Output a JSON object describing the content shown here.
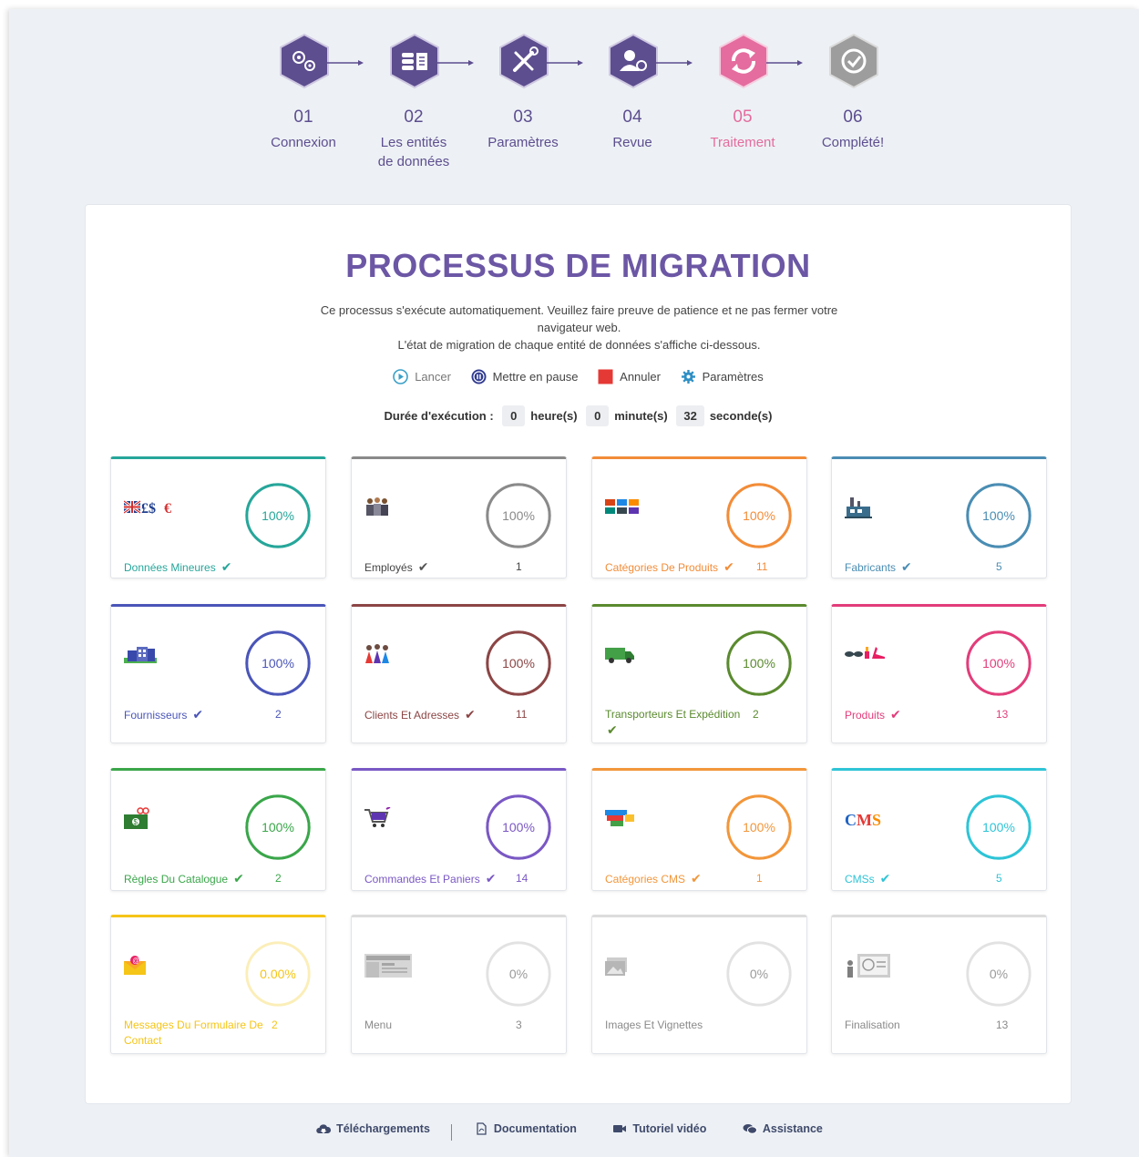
{
  "steps": [
    {
      "num": "01",
      "label": "Connexion",
      "state": "done"
    },
    {
      "num": "02",
      "label": "Les entités de données",
      "state": "done"
    },
    {
      "num": "03",
      "label": "Paramètres",
      "state": "done"
    },
    {
      "num": "04",
      "label": "Revue",
      "state": "done"
    },
    {
      "num": "05",
      "label": "Traitement",
      "state": "active"
    },
    {
      "num": "06",
      "label": "Complété!",
      "state": "pending"
    }
  ],
  "main": {
    "title": "PROCESSUS DE MIGRATION",
    "desc_line1": "Ce processus s'exécute automatiquement. Veuillez faire preuve de patience et ne pas fermer votre navigateur web.",
    "desc_line2": "L'état de migration de chaque entité de données s'affiche ci-dessous.",
    "controls": {
      "start": "Lancer",
      "pause": "Mettre en pause",
      "cancel": "Annuler",
      "settings": "Paramètres"
    },
    "duration": {
      "label": "Durée d'exécution :",
      "hours": "0",
      "hours_unit": "heure(s)",
      "minutes": "0",
      "minutes_unit": "minute(s)",
      "seconds": "32",
      "seconds_unit": "seconde(s)"
    }
  },
  "entities": [
    {
      "name": "Données Mineures",
      "percent": "100%",
      "progress": 1.0,
      "count": "",
      "color": "#26a69a",
      "checked": true,
      "icon": "currency-flags-icon"
    },
    {
      "name": "Employés",
      "percent": "100%",
      "progress": 1.0,
      "count": "1",
      "color": "#8a8a8a",
      "checked": true,
      "icon": "employees-icon"
    },
    {
      "name": "Catégories De Produits",
      "percent": "100%",
      "progress": 1.0,
      "count": "11",
      "color": "#f28c38",
      "checked": true,
      "icon": "categories-grid-icon"
    },
    {
      "name": "Fabricants",
      "percent": "100%",
      "progress": 1.0,
      "count": "5",
      "color": "#4a8db3",
      "checked": true,
      "icon": "factory-icon"
    },
    {
      "name": "Fournisseurs",
      "percent": "100%",
      "progress": 1.0,
      "count": "2",
      "color": "#4a55b8",
      "checked": true,
      "icon": "suppliers-icon"
    },
    {
      "name": "Clients Et Adresses",
      "percent": "100%",
      "progress": 1.0,
      "count": "11",
      "color": "#8c4545",
      "checked": true,
      "icon": "customers-icon"
    },
    {
      "name": "Transporteurs Et Expédition",
      "percent": "100%",
      "progress": 1.0,
      "count": "2",
      "color": "#5a8a2e",
      "checked": true,
      "icon": "truck-icon"
    },
    {
      "name": "Produits",
      "percent": "100%",
      "progress": 1.0,
      "count": "13",
      "color": "#e23d7a",
      "checked": true,
      "icon": "products-icon"
    },
    {
      "name": "Règles Du Catalogue",
      "percent": "100%",
      "progress": 1.0,
      "count": "2",
      "color": "#3aa64a",
      "checked": true,
      "icon": "catalog-rules-icon"
    },
    {
      "name": "Commandes Et Paniers",
      "percent": "100%",
      "progress": 1.0,
      "count": "14",
      "color": "#7a58c4",
      "checked": true,
      "icon": "cart-icon"
    },
    {
      "name": "Catégories CMS",
      "percent": "100%",
      "progress": 1.0,
      "count": "1",
      "color": "#f2963a",
      "checked": true,
      "icon": "cms-categories-icon"
    },
    {
      "name": "CMSs",
      "percent": "100%",
      "progress": 1.0,
      "count": "5",
      "color": "#2ec4d6",
      "checked": true,
      "icon": "cms-icon"
    },
    {
      "name": "Messages Du Formulaire De Contact",
      "percent": "0.00%",
      "progress": 0.0,
      "count": "2",
      "color": "#f5c518",
      "checked": false,
      "icon": "mail-icon"
    },
    {
      "name": "Menu",
      "percent": "0%",
      "progress": 0.0,
      "count": "3",
      "color": "#9a9a9a",
      "checked": false,
      "icon": "menu-icon"
    },
    {
      "name": "Images Et Vignettes",
      "percent": "0%",
      "progress": 0.0,
      "count": "",
      "color": "#9a9a9a",
      "checked": false,
      "icon": "images-icon"
    },
    {
      "name": "Finalisation",
      "percent": "0%",
      "progress": 0.0,
      "count": "13",
      "color": "#9a9a9a",
      "checked": false,
      "icon": "finalization-icon"
    }
  ],
  "cms_icon_text": "CMS",
  "footer": {
    "downloads": "Téléchargements",
    "documentation": "Documentation",
    "video": "Tutoriel vidéo",
    "support": "Assistance"
  }
}
